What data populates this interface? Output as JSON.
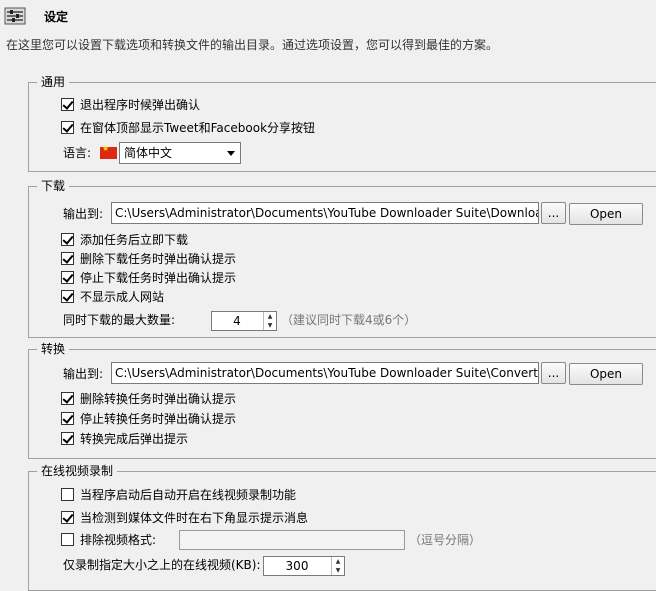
{
  "header": {
    "title": "设定",
    "description": "在这里您可以设置下载选项和转换文件的输出目录。通过选项设置，您可以得到最佳的方案。"
  },
  "general": {
    "legend": "通用",
    "confirm_exit": {
      "label": "退出程序时候弹出确认",
      "checked": true
    },
    "show_share": {
      "label": "在窗体顶部显示Tweet和Facebook分享按钮",
      "checked": true
    },
    "language_label": "语言:",
    "language_value": "简体中文"
  },
  "download": {
    "legend": "下载",
    "output_label": "输出到:",
    "output_path": "C:\\Users\\Administrator\\Documents\\YouTube Downloader Suite\\Download",
    "browse_label": "...",
    "open_label": "Open",
    "options": [
      {
        "label": "添加任务后立即下载",
        "checked": true
      },
      {
        "label": "删除下载任务时弹出确认提示",
        "checked": true
      },
      {
        "label": "停止下载任务时弹出确认提示",
        "checked": true
      },
      {
        "label": "不显示成人网站",
        "checked": true
      }
    ],
    "max_label": "同时下载的最大数量:",
    "max_value": "4",
    "max_hint": "（建议同时下载4或6个）"
  },
  "convert": {
    "legend": "转换",
    "output_label": "输出到:",
    "output_path": "C:\\Users\\Administrator\\Documents\\YouTube Downloader Suite\\Convert\\",
    "browse_label": "...",
    "open_label": "Open",
    "options": [
      {
        "label": "删除转换任务时弹出确认提示",
        "checked": true
      },
      {
        "label": "停止转换任务时弹出确认提示",
        "checked": true
      },
      {
        "label": "转换完成后弹出提示",
        "checked": true
      }
    ]
  },
  "record": {
    "legend": "在线视频录制",
    "auto_start": {
      "label": "当程序启动后自动开启在线视频录制功能",
      "checked": false
    },
    "notify": {
      "label": "当检测到媒体文件时在右下角显示提示消息",
      "checked": true
    },
    "exclude": {
      "label": "排除视频格式:",
      "checked": false,
      "value": "",
      "hint": "（逗号分隔）"
    },
    "min_size_label": "仅录制指定大小之上的在线视频(KB):",
    "min_size_value": "300"
  }
}
